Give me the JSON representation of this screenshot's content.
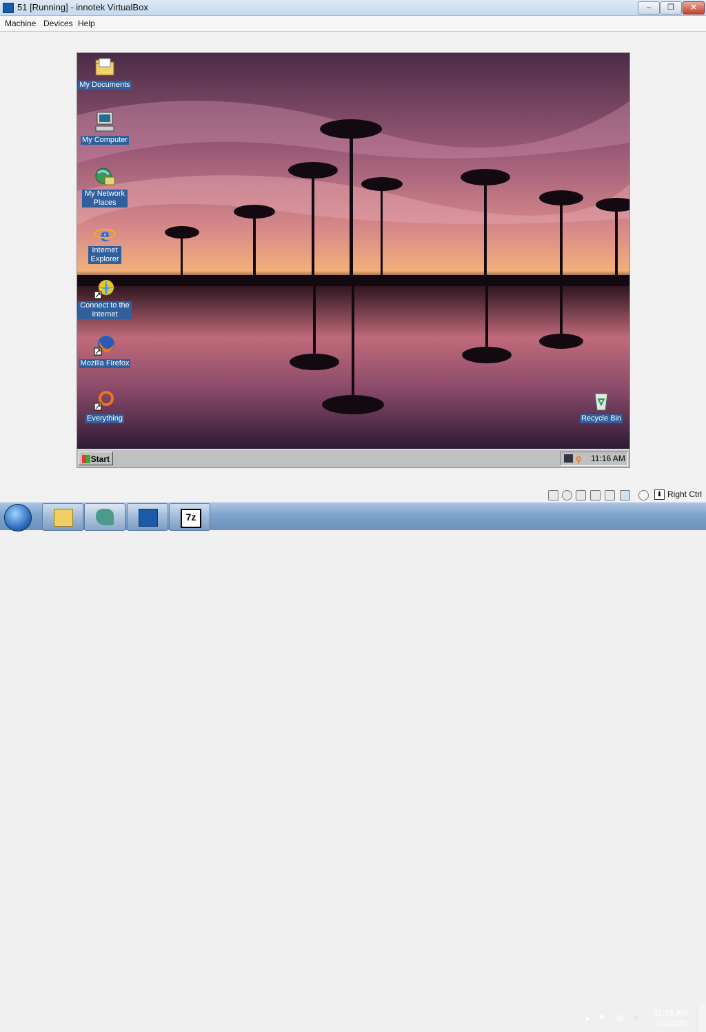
{
  "window": {
    "title": "51 [Running] - innotek VirtualBox",
    "app_icon": "virtualbox-icon",
    "buttons": {
      "minimize": "–",
      "maximize": "❐",
      "close": "✕"
    }
  },
  "menubar": {
    "items": [
      "Machine",
      "Devices",
      "Help"
    ]
  },
  "guest": {
    "desktop_icons": [
      {
        "label": "My Documents",
        "icon": "folder-icon"
      },
      {
        "label": "My Computer",
        "icon": "computer-icon"
      },
      {
        "label": "My Network Places",
        "icon": "network-icon"
      },
      {
        "label": "Internet Explorer",
        "icon": "ie-icon"
      },
      {
        "label": "Connect to the Internet",
        "icon": "connect-icon"
      },
      {
        "label": "Mozilla Firefox",
        "icon": "firefox-icon"
      },
      {
        "label": "Everything",
        "icon": "everything-icon"
      },
      {
        "label": "Recycle Bin",
        "icon": "recycle-bin-icon"
      }
    ],
    "taskbar": {
      "start_label": "Start",
      "clock": "11:16 AM"
    }
  },
  "statusbar": {
    "host_key": "Right Ctrl"
  },
  "host_taskbar": {
    "pinned": [
      "explorer-icon",
      "seahorse-icon",
      "virtualbox-icon",
      "7zip-icon"
    ],
    "clock_time": "11:16 AM",
    "clock_date": "2/1/2025"
  }
}
